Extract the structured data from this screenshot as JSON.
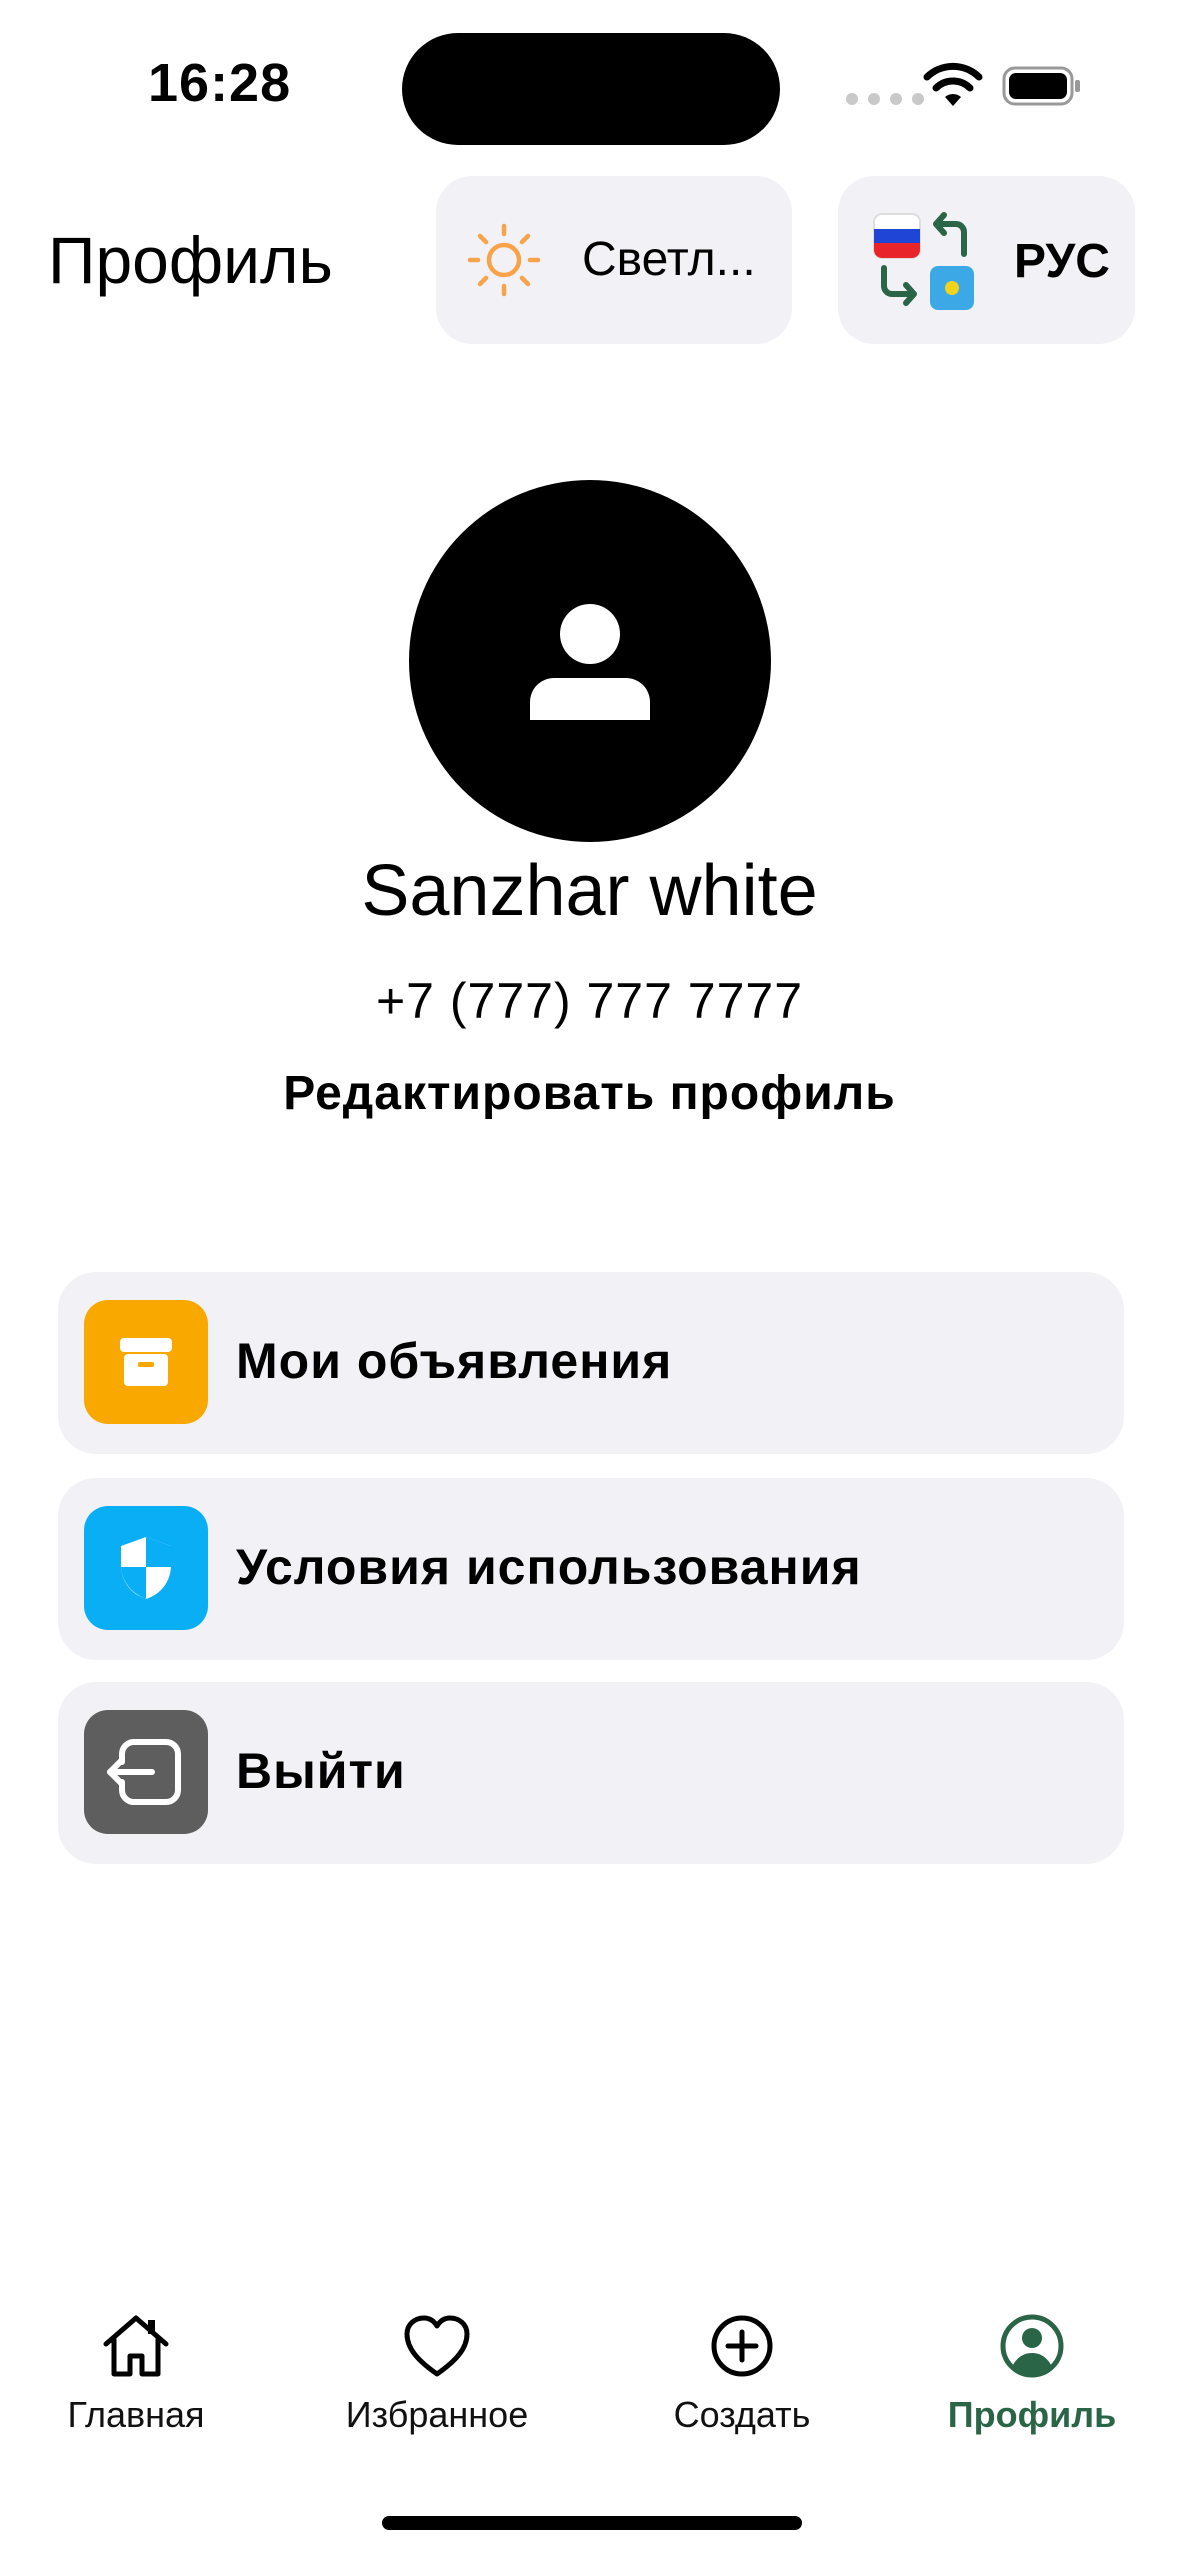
{
  "status_bar": {
    "time": "16:28"
  },
  "header": {
    "title": "Профиль",
    "theme_label": "Светл...",
    "language_label": "РУС"
  },
  "profile": {
    "name": "Sanzhar white",
    "phone": "+7 (777) 777 7777",
    "edit_label": "Редактировать профиль"
  },
  "menu": [
    {
      "label": "Мои объявления",
      "icon": "archive-icon",
      "color": "#F9A800"
    },
    {
      "label": "Условия использования",
      "icon": "shield-icon",
      "color": "#0AAEF5"
    },
    {
      "label": "Выйти",
      "icon": "logout-icon",
      "color": "#5E5E5E"
    }
  ],
  "tabs": [
    {
      "label": "Главная",
      "icon": "home-icon",
      "active": false
    },
    {
      "label": "Избранное",
      "icon": "heart-icon",
      "active": false
    },
    {
      "label": "Создать",
      "icon": "plus-circle-icon",
      "active": false
    },
    {
      "label": "Профиль",
      "icon": "profile-icon",
      "active": true
    }
  ],
  "colors": {
    "accent": "#2A6548",
    "card_background": "#F2F2F6",
    "sun": "#F6A34A"
  }
}
